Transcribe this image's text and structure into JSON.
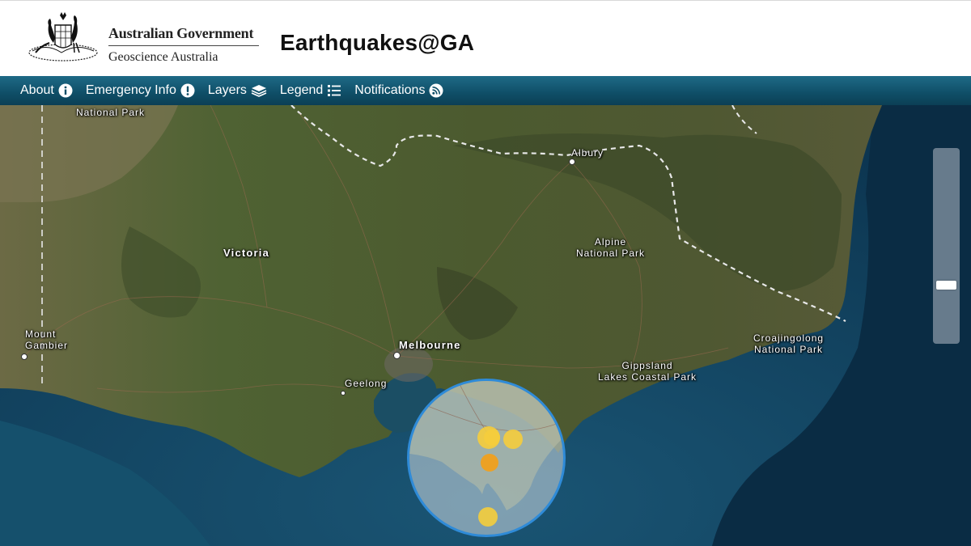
{
  "header": {
    "gov_line1": "Australian Government",
    "gov_line2": "Geoscience Australia",
    "app_title": "Earthquakes@GA"
  },
  "nav": [
    {
      "label": "About",
      "icon": "info-icon"
    },
    {
      "label": "Emergency Info",
      "icon": "alert-icon"
    },
    {
      "label": "Layers",
      "icon": "layers-icon"
    },
    {
      "label": "Legend",
      "icon": "list-icon"
    },
    {
      "label": "Notifications",
      "icon": "rss-icon"
    }
  ],
  "map": {
    "places": {
      "national_park_top": "National Park",
      "albury": "Albury",
      "victoria": "Victoria",
      "alpine_1": "Alpine",
      "alpine_2": "National Park",
      "mount_gambier_1": "Mount",
      "mount_gambier_2": "Gambier",
      "melbourne": "Melbourne",
      "geelong": "Geelong",
      "gippsland_1": "Gippsland",
      "gippsland_2": "Lakes Coastal Park",
      "croajingolong_1": "Croajingolong",
      "croajingolong_2": "National Park"
    },
    "colors": {
      "ocean": "#0f3f5c",
      "land": "#4d5a30",
      "cluster_border": "#2f8bd8",
      "quake_yellow": "#f5cd3c",
      "quake_orange": "#f0a01e"
    }
  }
}
